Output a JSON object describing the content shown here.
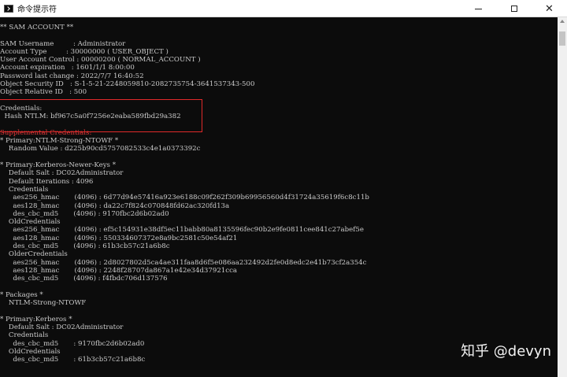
{
  "window": {
    "title": "命令提示符",
    "minimize_label": "",
    "maximize_label": "",
    "close_label": "✕"
  },
  "console_lines": [
    {
      "text": "** SAM ACCOUNT **",
      "red": false
    },
    {
      "text": "",
      "red": false
    },
    {
      "text": "SAM Username         : Administrator",
      "red": false
    },
    {
      "text": "Account Type         : 30000000 ( USER_OBJECT )",
      "red": false
    },
    {
      "text": "User Account Control : 00000200 ( NORMAL_ACCOUNT )",
      "red": false
    },
    {
      "text": "Account expiration   : 1601/1/1 8:00:00",
      "red": false
    },
    {
      "text": "Password last change : 2022/7/7 16:40:52",
      "red": false
    },
    {
      "text": "Object Security ID   : S-1-5-21-2248059810-2082735754-3641537343-500",
      "red": false
    },
    {
      "text": "Object Relative ID   : 500",
      "red": false
    },
    {
      "text": "",
      "red": false
    },
    {
      "text": "Credentials:",
      "red": false
    },
    {
      "text": "  Hash NTLM: bf967c5a0f7256e2eaba589fbd29a382",
      "red": false
    },
    {
      "text": "",
      "red": false
    },
    {
      "text": "Supplemental Credentials:",
      "red": true
    },
    {
      "text": "* Primary:NTLM-Strong-NTOWF *",
      "red": false
    },
    {
      "text": "    Random Value : d225b90cd5757082533c4e1a0373392c",
      "red": false
    },
    {
      "text": "",
      "red": false
    },
    {
      "text": "* Primary:Kerberos-Newer-Keys *",
      "red": false
    },
    {
      "text": "    Default Salt : DC02Administrator",
      "red": false
    },
    {
      "text": "    Default Iterations : 4096",
      "red": false
    },
    {
      "text": "    Credentials",
      "red": false
    },
    {
      "text": "      aes256_hmac       (4096) : 6d77d94e57416a923e6188c09f262f309b69956560d4f31724a35619f6c8c11b",
      "red": false
    },
    {
      "text": "      aes128_hmac       (4096) : da22c7f824c070848fd62ac320fd13a",
      "red": false
    },
    {
      "text": "      des_cbc_md5       (4096) : 9170fbc2d6b02ad0",
      "red": false
    },
    {
      "text": "    OldCredentials",
      "red": false
    },
    {
      "text": "      aes256_hmac       (4096) : ef5c154931e38df5ec11babb80a8135596fec90b2e9fe0811cee841c27abef5e",
      "red": false
    },
    {
      "text": "      aes128_hmac       (4096) : 550334607372e8a9bc2581c50e54af21",
      "red": false
    },
    {
      "text": "      des_cbc_md5       (4096) : 61b3cb57c21a6b8c",
      "red": false
    },
    {
      "text": "    OlderCredentials",
      "red": false
    },
    {
      "text": "      aes256_hmac       (4096) : 2d8027802d5ca4ae311faa8d6f5e086aa232492d2fe0d8edc2e41b73cf2a354c",
      "red": false
    },
    {
      "text": "      aes128_hmac       (4096) : 2248f28707da867a1e42e34d37921cca",
      "red": false
    },
    {
      "text": "      des_cbc_md5       (4096) : f4fbdc706d137576",
      "red": false
    },
    {
      "text": "",
      "red": false
    },
    {
      "text": "* Packages *",
      "red": false
    },
    {
      "text": "    NTLM-Strong-NTOWF",
      "red": false
    },
    {
      "text": "",
      "red": false
    },
    {
      "text": "* Primary:Kerberos *",
      "red": false
    },
    {
      "text": "    Default Salt : DC02Administrator",
      "red": false
    },
    {
      "text": "    Credentials",
      "red": false
    },
    {
      "text": "      des_cbc_md5       : 9170fbc2d6b02ad0",
      "red": false
    },
    {
      "text": "    OldCredentials",
      "red": false
    },
    {
      "text": "      des_cbc_md5       : 61b3cb57c21a6b8c",
      "red": false
    }
  ],
  "watermark": "知乎 @devyn",
  "colors": {
    "console_bg": "#0c0c0c",
    "console_text": "#cccccc",
    "highlight": "#e0292a",
    "supplemental_text": "#e03838"
  },
  "icons": [
    "cmd-app-icon",
    "minimize-icon",
    "maximize-icon",
    "close-icon",
    "scroll-up-icon"
  ]
}
